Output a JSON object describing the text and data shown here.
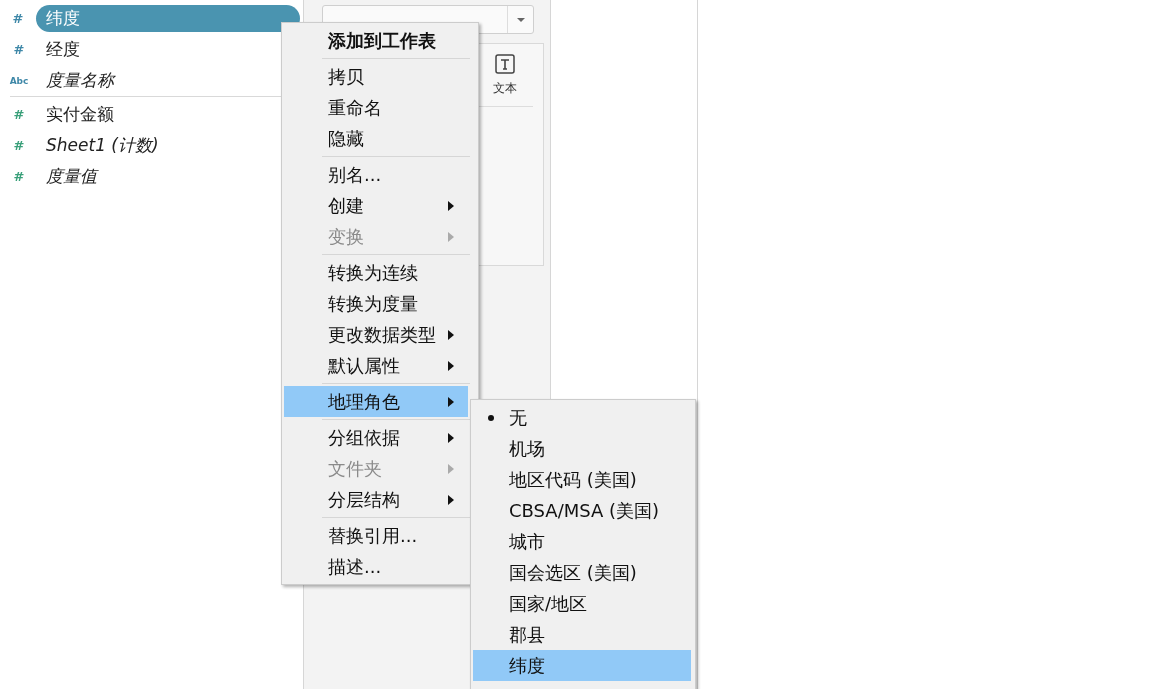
{
  "field_groups": [
    {
      "kind": "dimension",
      "items": [
        {
          "type_glyph": "#",
          "label": "纬度",
          "italic": false,
          "selected": true
        },
        {
          "type_glyph": "#",
          "label": "经度",
          "italic": false,
          "selected": false
        },
        {
          "type_glyph": "Abc",
          "label": "度量名称",
          "italic": true,
          "selected": false
        }
      ]
    },
    {
      "kind": "measure",
      "items": [
        {
          "type_glyph": "#",
          "label": "实付金额",
          "italic": false,
          "selected": false
        },
        {
          "type_glyph": "#",
          "label": "Sheet1 (计数)",
          "italic": true,
          "selected": false
        },
        {
          "type_glyph": "#",
          "label": "度量值",
          "italic": true,
          "selected": false
        }
      ]
    }
  ],
  "marks": {
    "buttons": [
      {
        "label": "文本"
      }
    ]
  },
  "context_menu": {
    "sections": [
      [
        {
          "label": "添加到工作表",
          "bold": true,
          "disabled": false,
          "submenu": false,
          "selected": false
        }
      ],
      [
        {
          "label": "拷贝",
          "bold": false,
          "disabled": false,
          "submenu": false,
          "selected": false
        },
        {
          "label": "重命名",
          "bold": false,
          "disabled": false,
          "submenu": false,
          "selected": false
        },
        {
          "label": "隐藏",
          "bold": false,
          "disabled": false,
          "submenu": false,
          "selected": false
        }
      ],
      [
        {
          "label": "别名...",
          "bold": false,
          "disabled": false,
          "submenu": false,
          "selected": false
        },
        {
          "label": "创建",
          "bold": false,
          "disabled": false,
          "submenu": true,
          "selected": false
        },
        {
          "label": "变换",
          "bold": false,
          "disabled": true,
          "submenu": true,
          "selected": false
        }
      ],
      [
        {
          "label": "转换为连续",
          "bold": false,
          "disabled": false,
          "submenu": false,
          "selected": false
        },
        {
          "label": "转换为度量",
          "bold": false,
          "disabled": false,
          "submenu": false,
          "selected": false
        },
        {
          "label": "更改数据类型",
          "bold": false,
          "disabled": false,
          "submenu": true,
          "selected": false
        },
        {
          "label": "默认属性",
          "bold": false,
          "disabled": false,
          "submenu": true,
          "selected": false
        }
      ],
      [
        {
          "label": "地理角色",
          "bold": false,
          "disabled": false,
          "submenu": true,
          "selected": true
        }
      ],
      [
        {
          "label": "分组依据",
          "bold": false,
          "disabled": false,
          "submenu": true,
          "selected": false
        },
        {
          "label": "文件夹",
          "bold": false,
          "disabled": true,
          "submenu": true,
          "selected": false
        },
        {
          "label": "分层结构",
          "bold": false,
          "disabled": false,
          "submenu": true,
          "selected": false
        }
      ],
      [
        {
          "label": "替换引用...",
          "bold": false,
          "disabled": false,
          "submenu": false,
          "selected": false
        },
        {
          "label": "描述...",
          "bold": false,
          "disabled": false,
          "submenu": false,
          "selected": false
        }
      ]
    ]
  },
  "geo_submenu": {
    "items": [
      {
        "label": "无",
        "checked": true,
        "selected": false
      },
      {
        "label": "机场",
        "checked": false,
        "selected": false
      },
      {
        "label": "地区代码 (美国)",
        "checked": false,
        "selected": false
      },
      {
        "label": "CBSA/MSA (美国)",
        "checked": false,
        "selected": false
      },
      {
        "label": "城市",
        "checked": false,
        "selected": false
      },
      {
        "label": "国会选区 (美国)",
        "checked": false,
        "selected": false
      },
      {
        "label": "国家/地区",
        "checked": false,
        "selected": false
      },
      {
        "label": "郡县",
        "checked": false,
        "selected": false
      },
      {
        "label": "纬度",
        "checked": false,
        "selected": true
      }
    ]
  }
}
